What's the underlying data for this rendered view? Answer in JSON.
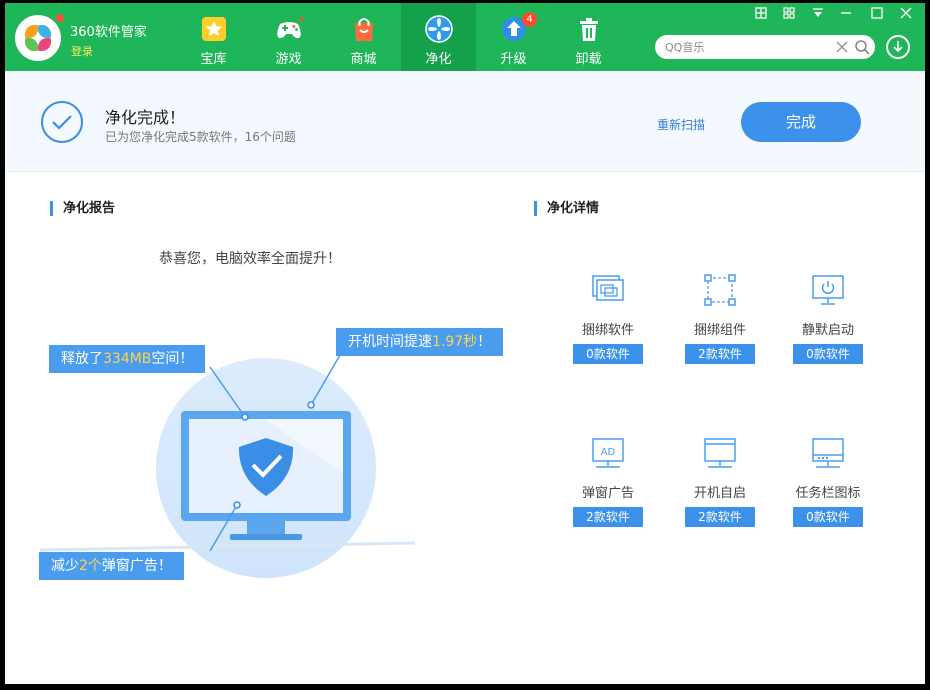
{
  "app": {
    "name": "360软件管家",
    "login_label": "登录"
  },
  "nav": [
    {
      "label": "宝库",
      "icon": "star-icon"
    },
    {
      "label": "游戏",
      "icon": "gamepad-icon"
    },
    {
      "label": "商城",
      "icon": "shopping-bag-icon"
    },
    {
      "label": "净化",
      "icon": "purify-fan-icon"
    },
    {
      "label": "升级",
      "icon": "upgrade-arrow-icon",
      "badge": "4"
    },
    {
      "label": "卸载",
      "icon": "trash-icon"
    }
  ],
  "active_nav": "净化",
  "search": {
    "placeholder": "QQ音乐"
  },
  "status": {
    "title": "净化完成！",
    "subtitle": "已为您净化完成5款软件，16个问题",
    "rescan_label": "重新扫描",
    "done_label": "完成"
  },
  "report": {
    "title": "净化报告",
    "congrats": "恭喜您，电脑效率全面提升！",
    "callouts": {
      "space": {
        "prefix": "释放了",
        "value": "334MB",
        "suffix": "空间！"
      },
      "boot": {
        "prefix": "开机时间提速",
        "value": "1.97秒",
        "suffix": "！"
      },
      "ads": {
        "prefix": "减少",
        "value": "2个",
        "suffix": "弹窗广告！"
      }
    }
  },
  "details": {
    "title": "净化详情",
    "items": [
      {
        "label": "捆绑软件",
        "count": "0款软件",
        "icon": "bundled-software-icon"
      },
      {
        "label": "捆绑组件",
        "count": "2款软件",
        "icon": "bundled-component-icon"
      },
      {
        "label": "静默启动",
        "count": "0款软件",
        "icon": "silent-startup-icon"
      },
      {
        "label": "弹窗广告",
        "count": "2款软件",
        "icon": "popup-ad-icon"
      },
      {
        "label": "开机自启",
        "count": "2款软件",
        "icon": "autostart-icon"
      },
      {
        "label": "任务栏图标",
        "count": "0款软件",
        "icon": "taskbar-icon"
      }
    ]
  },
  "colors": {
    "header_green": "#1fb659",
    "accent_blue": "#3c92ea",
    "highlight_yellow": "#ffd34d"
  }
}
